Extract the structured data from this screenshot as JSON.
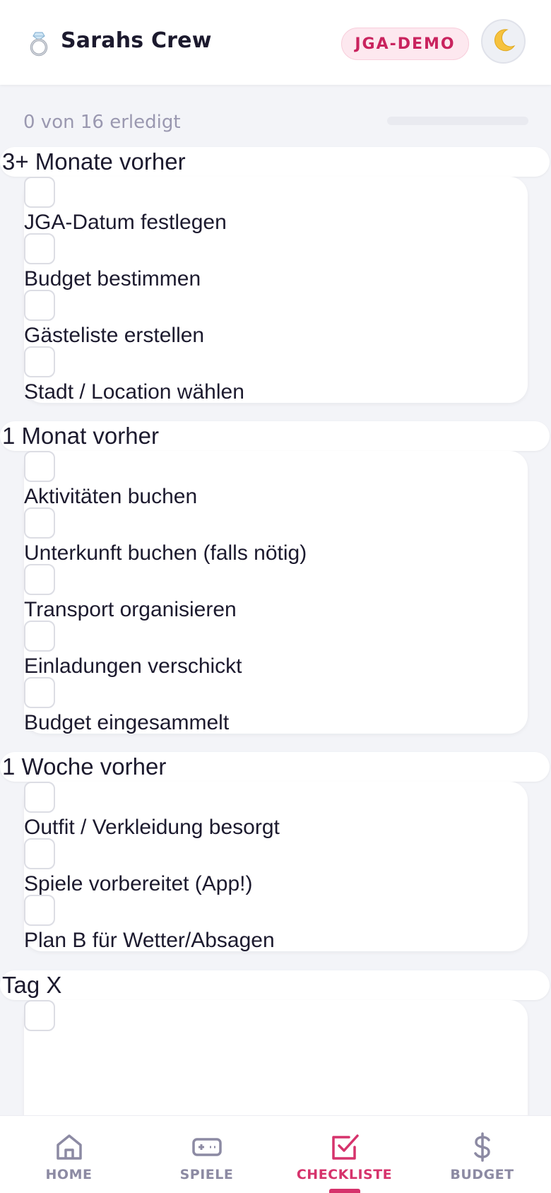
{
  "header": {
    "title": "Sarahs Crew",
    "ring_icon": "ring-icon",
    "badge": "JGA-DEMO",
    "theme_icon": "moon-icon"
  },
  "progress": {
    "text": "0 von 16 erledigt",
    "done": 0,
    "total": 16
  },
  "sections": [
    {
      "title": "3+ Monate vorher",
      "items": [
        {
          "label": "JGA-Datum festlegen",
          "checked": false
        },
        {
          "label": "Budget bestimmen",
          "checked": false
        },
        {
          "label": "Gästeliste erstellen",
          "checked": false
        },
        {
          "label": "Stadt / Location wählen",
          "checked": false
        }
      ]
    },
    {
      "title": "1 Monat vorher",
      "items": [
        {
          "label": "Aktivitäten buchen",
          "checked": false
        },
        {
          "label": "Unterkunft buchen (falls nötig)",
          "checked": false
        },
        {
          "label": "Transport organisieren",
          "checked": false
        },
        {
          "label": "Einladungen verschickt",
          "checked": false
        },
        {
          "label": "Budget eingesammelt",
          "checked": false
        }
      ]
    },
    {
      "title": "1 Woche vorher",
      "items": [
        {
          "label": "Outfit / Verkleidung besorgt",
          "checked": false
        },
        {
          "label": "Spiele vorbereitet (App!)",
          "checked": false
        },
        {
          "label": "Plan B für Wetter/Absagen",
          "checked": false
        }
      ]
    },
    {
      "title": "Tag X",
      "items": [
        {
          "label": "",
          "checked": false
        }
      ]
    }
  ],
  "nav": {
    "items": [
      {
        "label": "HOME",
        "icon": "home-icon",
        "active": false
      },
      {
        "label": "SPIELE",
        "icon": "gamepad-icon",
        "active": false
      },
      {
        "label": "CHECKLISTE",
        "icon": "checklist-icon",
        "active": true
      },
      {
        "label": "BUDGET",
        "icon": "dollar-icon",
        "active": false
      }
    ]
  },
  "colors": {
    "accent": "#d6336c",
    "background": "#f3f4f8",
    "muted": "#8c8aa3"
  }
}
